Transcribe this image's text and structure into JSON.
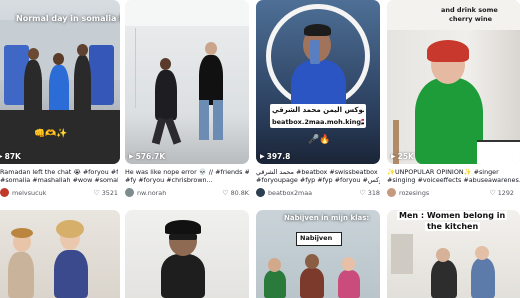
{
  "videos": [
    {
      "views": "87K",
      "overlay": "Normal day in somalia 🤪",
      "caption": "Ramadan left the chat 😭 #foryou #fyp",
      "caption2": "#somalia #mashallah #wow #somalitikto...",
      "user": "melvsucuk",
      "likes": "3521"
    },
    {
      "views": "576.7K",
      "caption": "He was like nope error 💀 // #friends #fyp",
      "caption2": "#fy #foryou #chrisbrown...",
      "user": "nw.norah",
      "likes": "80.8K"
    },
    {
      "views": "397.8",
      "overlay": "بيت بوكس اليمن محمد الشرقي",
      "overlay2": "beatbox.2maa.moh.king🇾🇪",
      "caption": "محمد الشرقي #beatbox #swissbeatbox",
      "caption2": "#foryoupage #fyp #fyp #foryou #بيتبوكس",
      "user": "beatbox2maa",
      "likes": "318"
    },
    {
      "views": "25K",
      "overlay": "and drink some",
      "overlay2": "cherry wine",
      "caption": "✨UNPOPULAR OPINION✨ #singer",
      "caption2": "#singing #voiceeffects #abuseawarenes...",
      "user": "rozesings",
      "likes": "1292"
    },
    {
      "views": "",
      "caption": "",
      "user": "",
      "likes": ""
    },
    {
      "views": "",
      "caption": "",
      "user": "",
      "likes": ""
    },
    {
      "views": "",
      "overlay": "Nabijven in mijn klas:",
      "overlay2": "Nabijven",
      "caption": "",
      "user": "",
      "likes": ""
    },
    {
      "views": "",
      "overlay": "Men : Women belong in",
      "overlay2": "the kitchen",
      "caption": "",
      "user": "",
      "likes": ""
    }
  ],
  "icons": {
    "play": "play-icon",
    "heart": "heart-icon"
  },
  "colors": {
    "text": "#161823",
    "muted": "#75767c"
  }
}
